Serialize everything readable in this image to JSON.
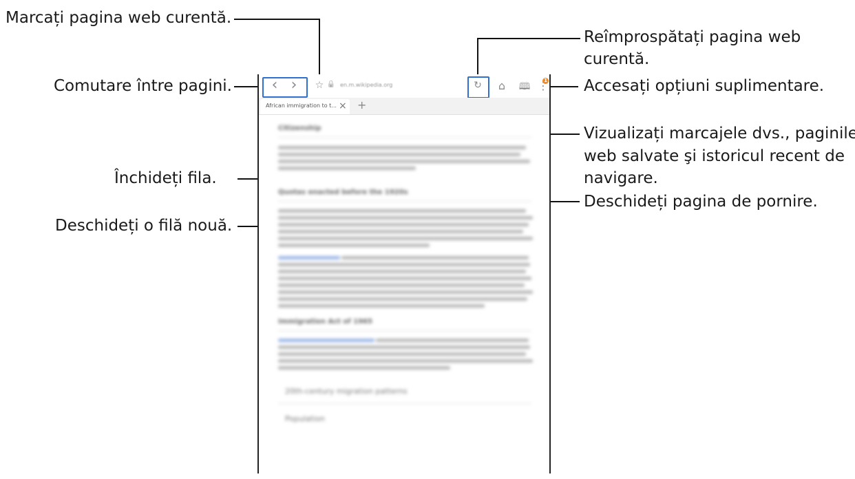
{
  "callouts": {
    "bookmark": "Marcați pagina web curentă.",
    "switch_pages": "Comutare între pagini.",
    "close_tab": "Închideți fila.",
    "new_tab": "Deschideți o filă nouă.",
    "refresh_line1": "Reîmprospătați pagina web",
    "refresh_line2": "curentă.",
    "more_options": "Accesați opțiuni suplimentare.",
    "bookmarks_line1": "Vizualizați marcajele dvs., paginile",
    "bookmarks_line2": "web salvate şi istoricul recent de",
    "bookmarks_line3": "navigare.",
    "home": "Deschideți pagina de pornire."
  },
  "browser": {
    "url": "en.m.wikipedia.org",
    "tab_title": "African immigration to t...",
    "close_tab_glyph": "×",
    "new_tab_glyph": "+",
    "back_glyph": "‹",
    "forward_glyph": "›",
    "star_glyph": "☆",
    "lock_glyph": "🔒",
    "refresh_glyph": "↻",
    "home_glyph": "⌂",
    "bookmarks_glyph": "🕮",
    "more_glyph": "⋮",
    "notification_count": "1",
    "accent_color": "#f08a24"
  },
  "page": {
    "section1": "Citizenship",
    "section2": "Quotas enacted before the 1920s",
    "section3": "Immigration Act of 1965",
    "section4": "20th-century migration patterns",
    "section5": "Population"
  }
}
